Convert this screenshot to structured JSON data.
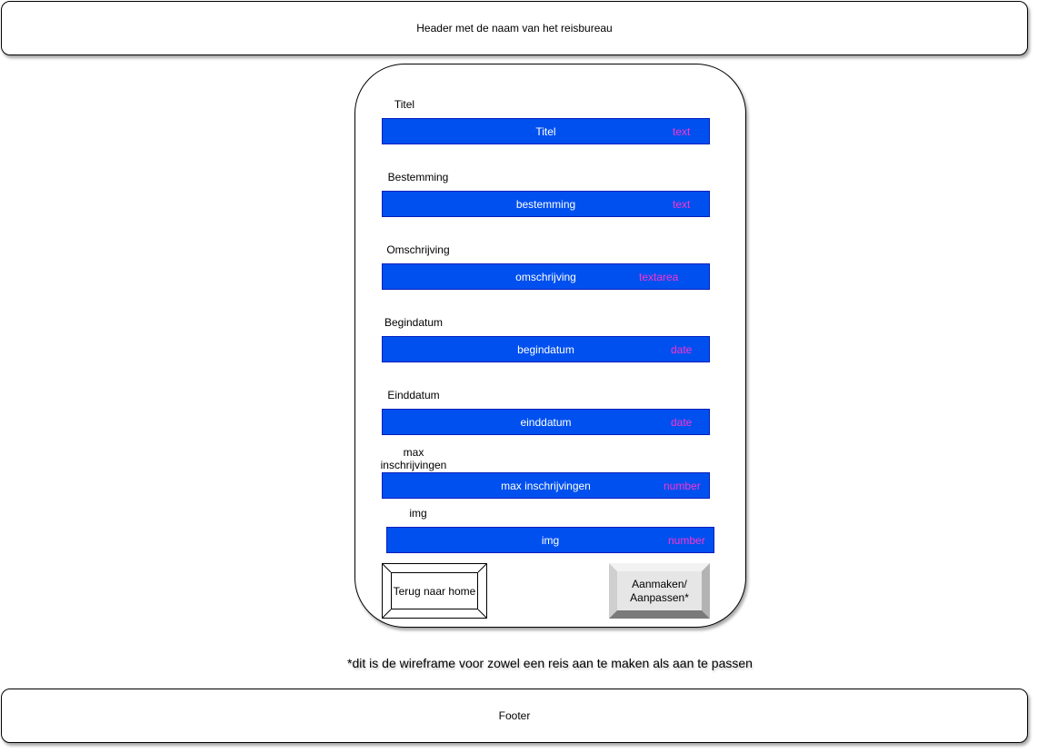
{
  "header": {
    "text": "Header met de naam van het reisbureau"
  },
  "form": {
    "fields": [
      {
        "label": "Titel",
        "name": "Titel",
        "type": "text"
      },
      {
        "label": "Bestemming",
        "name": "bestemming",
        "type": "text"
      },
      {
        "label": "Omschrijving",
        "name": "omschrijving",
        "type": "textarea"
      },
      {
        "label": "Begindatum",
        "name": "begindatum",
        "type": "date"
      },
      {
        "label": "Einddatum",
        "name": "einddatum",
        "type": "date"
      },
      {
        "label": "max inschrijvingen",
        "name": "max inschrijvingen",
        "type": "number"
      },
      {
        "label": "img",
        "name": "img",
        "type": "number"
      }
    ],
    "back_button": "Terug naar home",
    "submit_button": "Aanmaken/ Aanpassen*"
  },
  "note": "*dit is de wireframe voor zowel een reis aan te maken als aan te passen",
  "footer": {
    "text": "Footer"
  },
  "colors": {
    "input_fill": "#0050ef",
    "input_border": "#001dbc",
    "type_text": "#ff33cc",
    "button_grey": "#e6e6e6"
  }
}
